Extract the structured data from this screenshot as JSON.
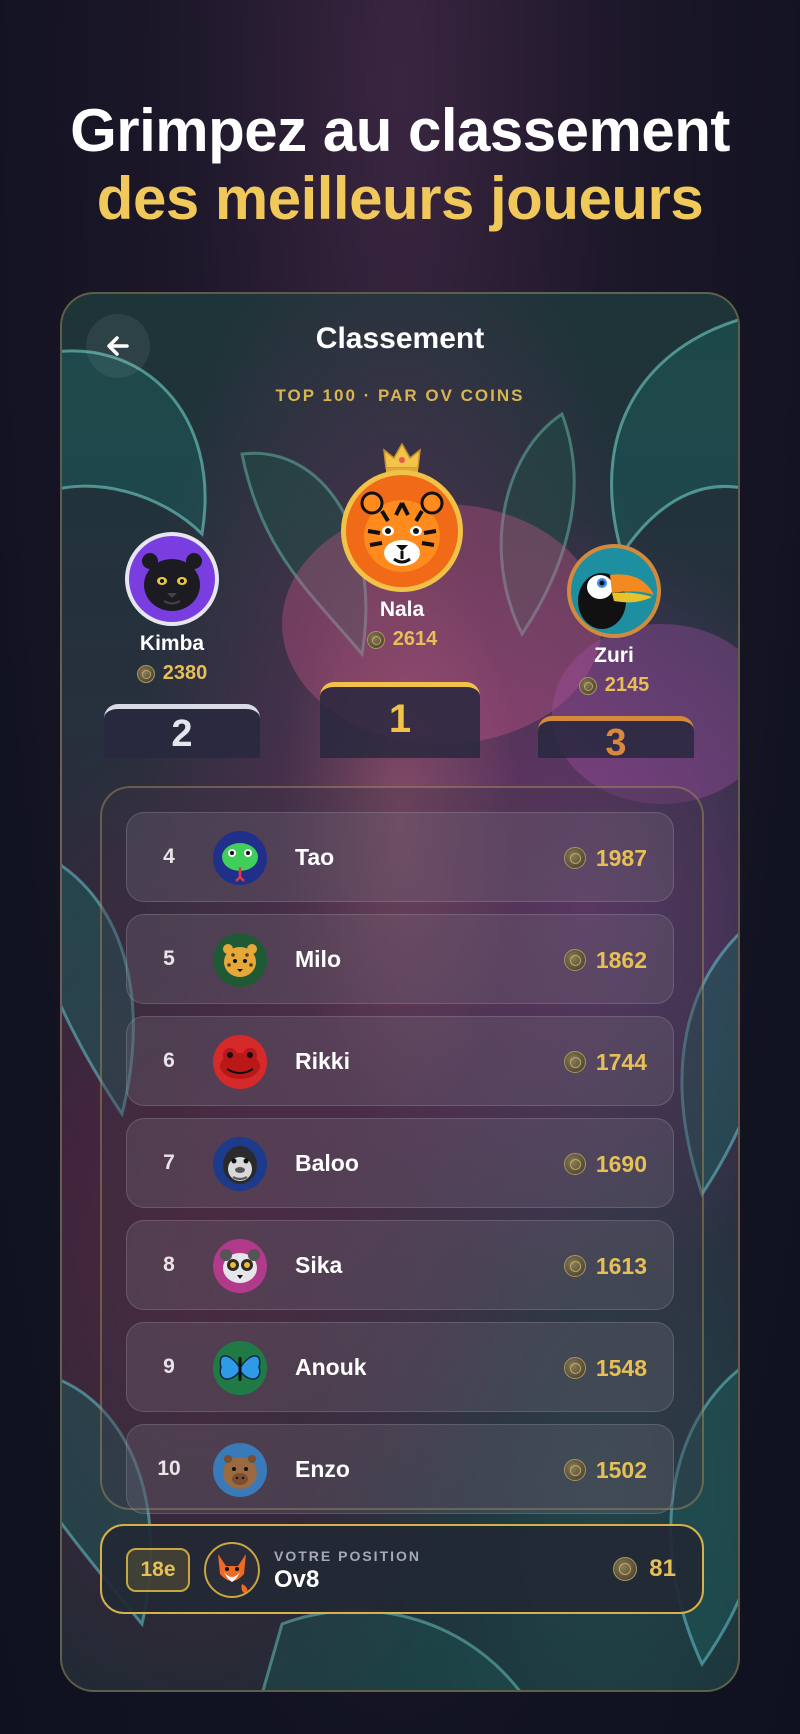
{
  "promo": {
    "line1": "Grimpez au classement",
    "line2": "des meilleurs joueurs"
  },
  "header": {
    "title": "Classement",
    "subtitle": "TOP 100 · PAR OV COINS",
    "back_icon": "arrow-left-icon"
  },
  "podium": {
    "first": {
      "rank": "1",
      "name": "Nala",
      "score": "2614",
      "avatar": "tiger-avatar"
    },
    "second": {
      "rank": "2",
      "name": "Kimba",
      "score": "2380",
      "avatar": "panther-avatar"
    },
    "third": {
      "rank": "3",
      "name": "Zuri",
      "score": "2145",
      "avatar": "toucan-avatar"
    }
  },
  "leaderboard": [
    {
      "rank": "4",
      "name": "Tao",
      "score": "1987",
      "avatar": "snake-avatar"
    },
    {
      "rank": "5",
      "name": "Milo",
      "score": "1862",
      "avatar": "jaguar-avatar"
    },
    {
      "rank": "6",
      "name": "Rikki",
      "score": "1744",
      "avatar": "frog-avatar"
    },
    {
      "rank": "7",
      "name": "Baloo",
      "score": "1690",
      "avatar": "gorilla-avatar"
    },
    {
      "rank": "8",
      "name": "Sika",
      "score": "1613",
      "avatar": "lemur-avatar"
    },
    {
      "rank": "9",
      "name": "Anouk",
      "score": "1548",
      "avatar": "butterfly-avatar"
    },
    {
      "rank": "10",
      "name": "Enzo",
      "score": "1502",
      "avatar": "capybara-avatar"
    }
  ],
  "my_position": {
    "rank": "18e",
    "label": "VOTRE POSITION",
    "name": "Ov8",
    "score": "81",
    "avatar": "fox-avatar"
  },
  "colors": {
    "gold": "#e6bf57",
    "silver": "#d8dbe6",
    "bronze": "#d48a3c",
    "headline_gold": "#f1c85a"
  }
}
